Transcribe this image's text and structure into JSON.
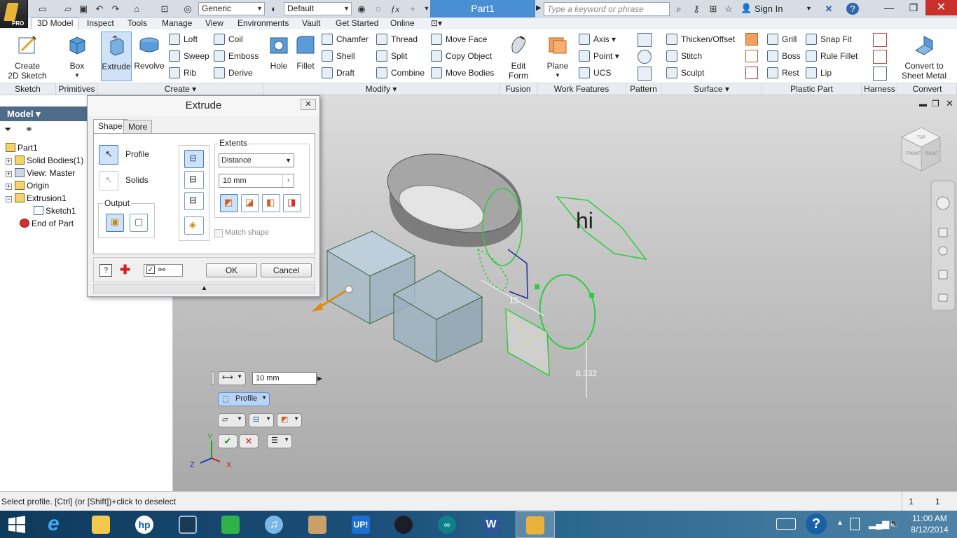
{
  "titlebar": {
    "material_combo": "Generic",
    "appearance_combo": "Default",
    "document_title": "Part1",
    "search_placeholder": "Type a keyword or phrase",
    "sign_in": "Sign In",
    "app_badge": "PRO"
  },
  "ribbon_tabs": [
    "3D Model",
    "Inspect",
    "Tools",
    "Manage",
    "View",
    "Environments",
    "Vault",
    "Get Started",
    "Online"
  ],
  "ribbon": {
    "sketch": {
      "create_label": "Create",
      "create_label2": "2D Sketch",
      "panel": "Sketch"
    },
    "primitives": {
      "box_label": "Box",
      "panel": "Primitives"
    },
    "create": {
      "extrude": "Extrude",
      "revolve": "Revolve",
      "loft": "Loft",
      "sweep": "Sweep",
      "rib": "Rib",
      "coil": "Coil",
      "emboss": "Emboss",
      "derive": "Derive",
      "panel": "Create"
    },
    "modify": {
      "hole": "Hole",
      "fillet": "Fillet",
      "chamfer": "Chamfer",
      "shell": "Shell",
      "draft": "Draft",
      "thread": "Thread",
      "split": "Split",
      "combine": "Combine",
      "move_face": "Move Face",
      "copy_object": "Copy Object",
      "move_bodies": "Move Bodies",
      "panel": "Modify"
    },
    "fusion": {
      "edit_form": "Edit",
      "edit_form2": "Form",
      "panel": "Fusion"
    },
    "work": {
      "plane": "Plane",
      "axis": "Axis",
      "point": "Point",
      "ucs": "UCS",
      "panel": "Work Features"
    },
    "pattern": {
      "panel": "Pattern"
    },
    "surface": {
      "thicken": "Thicken/Offset",
      "stitch": "Stitch",
      "sculpt": "Sculpt",
      "panel": "Surface"
    },
    "plastic": {
      "grill": "Grill",
      "boss": "Boss",
      "rest": "Rest",
      "snap_fit": "Snap Fit",
      "rule_fillet": "Rule Fillet",
      "lip": "Lip",
      "panel": "Plastic Part"
    },
    "harness": {
      "panel": "Harness"
    },
    "convert": {
      "label": "Convert to",
      "label2": "Sheet Metal",
      "panel": "Convert"
    }
  },
  "model_browser": {
    "header": "Model",
    "items": [
      "Part1",
      "Solid Bodies(1)",
      "View: Master",
      "Origin",
      "Extrusion1",
      "Sketch1",
      "End of Part"
    ]
  },
  "dialog": {
    "title": "Extrude",
    "tab_shape": "Shape",
    "tab_more": "More",
    "profile_label": "Profile",
    "solids_label": "Solids",
    "output_label": "Output",
    "extents_label": "Extents",
    "extents_type": "Distance",
    "distance_value": "10 mm",
    "match_shape": "Match shape",
    "ok": "OK",
    "cancel": "Cancel"
  },
  "viewport": {
    "sketch_text": "hi",
    "dim_15": "15",
    "dim_8332": "8.332",
    "cube_top": "TOP",
    "cube_front": "FRONT",
    "cube_right": "RIGHT",
    "axis_x": "X",
    "axis_y": "Y",
    "axis_z": "Z"
  },
  "minitoolbar": {
    "distance_value": "10 mm",
    "profile_label": "Profile"
  },
  "statusbar": {
    "prompt": "Select profile. [Ctrl] (or [Shift])+click to deselect",
    "count1": "1",
    "count2": "1"
  },
  "taskbar": {
    "time": "11:00 AM",
    "date": "8/12/2014",
    "apps": [
      "Internet Explorer",
      "File Explorer",
      "HP",
      "Camera",
      "Store",
      "iTunes",
      "Photos",
      "UP!",
      "Steam",
      "Arduino",
      "Word",
      "Inventor"
    ]
  }
}
